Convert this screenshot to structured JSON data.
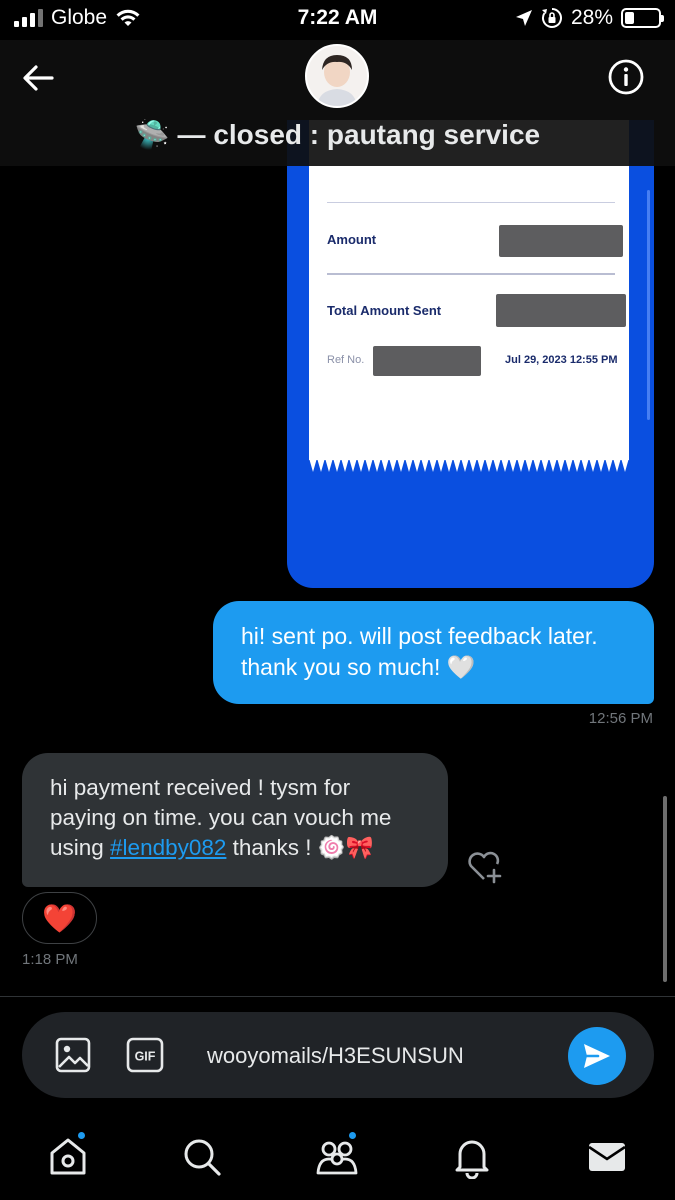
{
  "status_bar": {
    "carrier": "Globe",
    "time": "7:22 AM",
    "battery": "28%",
    "battery_level": 0.28
  },
  "header": {
    "title": "🛸 — closed : pautang service",
    "avatar": "contact-avatar",
    "back_icon": "back-arrow-icon",
    "info_icon": "info-icon"
  },
  "receipt": {
    "amount_label": "Amount",
    "total_label": "Total Amount Sent",
    "ref_label": "Ref No.",
    "date": "Jul 29, 2023 12:55 PM"
  },
  "messages": {
    "sent": {
      "text_line1": "hi! sent po. will post feedback later.",
      "text_line2": "thank you so much! 🤍",
      "time": "12:56 PM"
    },
    "received": {
      "text_line1": "hi payment received ! tysm for",
      "text_line2": "paying on time. you can vouch me",
      "text_line3_pre": "using ",
      "hashtag": "#lendby082",
      "text_line3_post": " thanks ! 🍥🎀",
      "reaction": "❤️",
      "time": "1:18 PM"
    }
  },
  "composer": {
    "value": "wooyomails/H3ESUNSUN",
    "gif_label": "GIF"
  },
  "tabbar": {
    "items": [
      "home-icon",
      "search-icon",
      "communities-icon",
      "notifications-icon",
      "messages-icon"
    ]
  },
  "colors": {
    "accent": "#1d9bf0",
    "bubble_received": "#2f3336",
    "receipt_blue": "#0a4fe0"
  }
}
